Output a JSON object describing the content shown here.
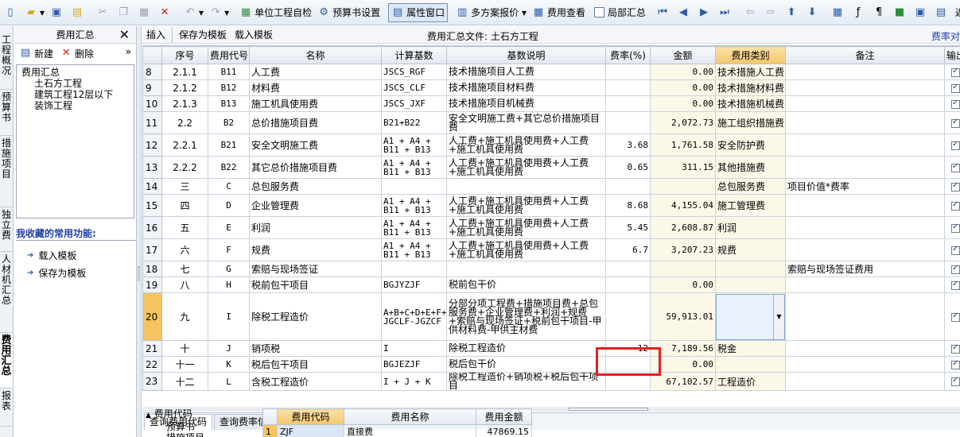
{
  "toolbar": {
    "self_check": "单位工程自检",
    "budget_settings": "预算书设置",
    "property_window": "属性窗口",
    "multi_quote": "多方案报价",
    "fee_view": "费用查看",
    "partial_summary": "局部汇总",
    "back_label": "返"
  },
  "vtabs": [
    "工程概况",
    "预算书",
    "措施项目",
    "独立费",
    "人材机汇总",
    "费用汇总",
    "报表"
  ],
  "left_panel": {
    "title": "费用汇总",
    "new_label": "新建",
    "delete_label": "删除",
    "tree": {
      "root": "费用汇总",
      "children": [
        "土石方工程",
        "建筑工程12层以下",
        "装饰工程"
      ]
    },
    "favorites_title": "我收藏的常用功能:",
    "favorites": [
      "载入模板",
      "保存为模板"
    ]
  },
  "sub_toolbar": {
    "insert": "插入",
    "save_template": "保存为模板",
    "load_template": "载入模板",
    "file_label": "费用汇总文件: 土石方工程",
    "rate_label": "费率对"
  },
  "grid": {
    "columns": [
      "序号",
      "费用代号",
      "名称",
      "计算基数",
      "基数说明",
      "费率(%)",
      "金额",
      "费用类别",
      "备注",
      "输出"
    ],
    "rows": [
      {
        "rn": "8",
        "seq": "2.1.1",
        "code": "B11",
        "name": "人工费",
        "base": "JSCS_RGF",
        "desc": "技术措施项目人工费",
        "rate": "",
        "amount": "0.00",
        "cat": "技术措施人工费",
        "note": ""
      },
      {
        "rn": "9",
        "seq": "2.1.2",
        "code": "B12",
        "name": "材料费",
        "base": "JSCS_CLF",
        "desc": "技术措施项目材料费",
        "rate": "",
        "amount": "0.00",
        "cat": "技术措施材料费",
        "note": ""
      },
      {
        "rn": "10",
        "seq": "2.1.3",
        "code": "B13",
        "name": "施工机具使用费",
        "base": "JSCS_JXF",
        "desc": "技术措施项目机械费",
        "rate": "",
        "amount": "0.00",
        "cat": "技术措施机械费",
        "note": ""
      },
      {
        "rn": "11",
        "seq": "2.2",
        "code": "B2",
        "name": "总价措施项目费",
        "base": "B21+B22",
        "desc": "安全文明施工费+其它总价措施项目费",
        "rate": "",
        "amount": "2,072.73",
        "cat": "施工组织措施费",
        "note": ""
      },
      {
        "rn": "12",
        "seq": "2.2.1",
        "code": "B21",
        "name": "安全文明施工费",
        "base": "A1 + A4 + B11 + B13",
        "desc": "人工费+施工机具使用费+人工费+施工机具使用费",
        "rate": "3.68",
        "amount": "1,761.58",
        "cat": "安全防护费",
        "note": ""
      },
      {
        "rn": "13",
        "seq": "2.2.2",
        "code": "B22",
        "name": "其它总价措施项目费",
        "base": "A1 + A4 + B11 + B13",
        "desc": "人工费+施工机具使用费+人工费+施工机具使用费",
        "rate": "0.65",
        "amount": "311.15",
        "cat": "其他措施费",
        "note": ""
      },
      {
        "rn": "14",
        "seq": "三",
        "code": "C",
        "name": "总包服务费",
        "base": "",
        "desc": "",
        "rate": "",
        "amount": "",
        "cat": "总包服务费",
        "note": "项目价值*费率"
      },
      {
        "rn": "15",
        "seq": "四",
        "code": "D",
        "name": "企业管理费",
        "base": "A1 + A4 + B11 + B13",
        "desc": "人工费+施工机具使用费+人工费+施工机具使用费",
        "rate": "8.68",
        "amount": "4,155.04",
        "cat": "施工管理费",
        "note": ""
      },
      {
        "rn": "16",
        "seq": "五",
        "code": "E",
        "name": "利润",
        "base": "A1 + A4 + B11 + B13",
        "desc": "人工费+施工机具使用费+人工费+施工机具使用费",
        "rate": "5.45",
        "amount": "2,608.87",
        "cat": "利润",
        "note": ""
      },
      {
        "rn": "17",
        "seq": "六",
        "code": "F",
        "name": "规费",
        "base": "A1 + A4 + B11 + B13",
        "desc": "人工费+施工机具使用费+人工费+施工机具使用费",
        "rate": "6.7",
        "amount": "3,207.23",
        "cat": "规费",
        "note": ""
      },
      {
        "rn": "18",
        "seq": "七",
        "code": "G",
        "name": "索赔与现场签证",
        "base": "",
        "desc": "",
        "rate": "",
        "amount": "",
        "cat": "",
        "note": "索赔与现场签证费用"
      },
      {
        "rn": "19",
        "seq": "八",
        "code": "H",
        "name": "税前包干项目",
        "base": "BGJYZJF",
        "desc": "税前包干价",
        "rate": "",
        "amount": "0.00",
        "cat": "",
        "note": ""
      },
      {
        "rn": "20",
        "seq": "九",
        "code": "I",
        "name": "除税工程造价",
        "base": "A+B+C+D+E+F+G+H-JGCLF-JGZCF",
        "desc": "分部分项工程费+措施项目费+总包服务费+企业管理费+利润+规费+索赔与现场签证+税前包干项目-甲供材料费-甲供主材费",
        "rate": "",
        "amount": "59,913.01",
        "cat": "",
        "note": ""
      },
      {
        "rn": "21",
        "seq": "十",
        "code": "J",
        "name": "销项税",
        "base": "I",
        "desc": "除税工程造价",
        "rate": "12",
        "amount": "7,189.56",
        "cat": "税金",
        "note": ""
      },
      {
        "rn": "22",
        "seq": "十一",
        "code": "K",
        "name": "税后包干项目",
        "base": "BGJEZJF",
        "desc": "税后包干价",
        "rate": "",
        "amount": "0.00",
        "cat": "",
        "note": ""
      },
      {
        "rn": "23",
        "seq": "十二",
        "code": "L",
        "name": "含税工程造价",
        "base": "I + J + K",
        "desc": "除税工程造价+销项税+税后包干项目",
        "rate": "",
        "amount": "67,102.57",
        "cat": "工程造价",
        "note": ""
      }
    ]
  },
  "bottom": {
    "tab1": "查询费用代码",
    "tab2": "查询费率信息",
    "tree_root": "费用代码",
    "tree_child1": "预算书",
    "tree_child2": "措施项目",
    "cols": [
      "费用代码",
      "费用名称",
      "费用金额"
    ],
    "row": {
      "rn": "1",
      "code": "ZJF",
      "name": "直接费",
      "amount": "47869.15"
    }
  }
}
